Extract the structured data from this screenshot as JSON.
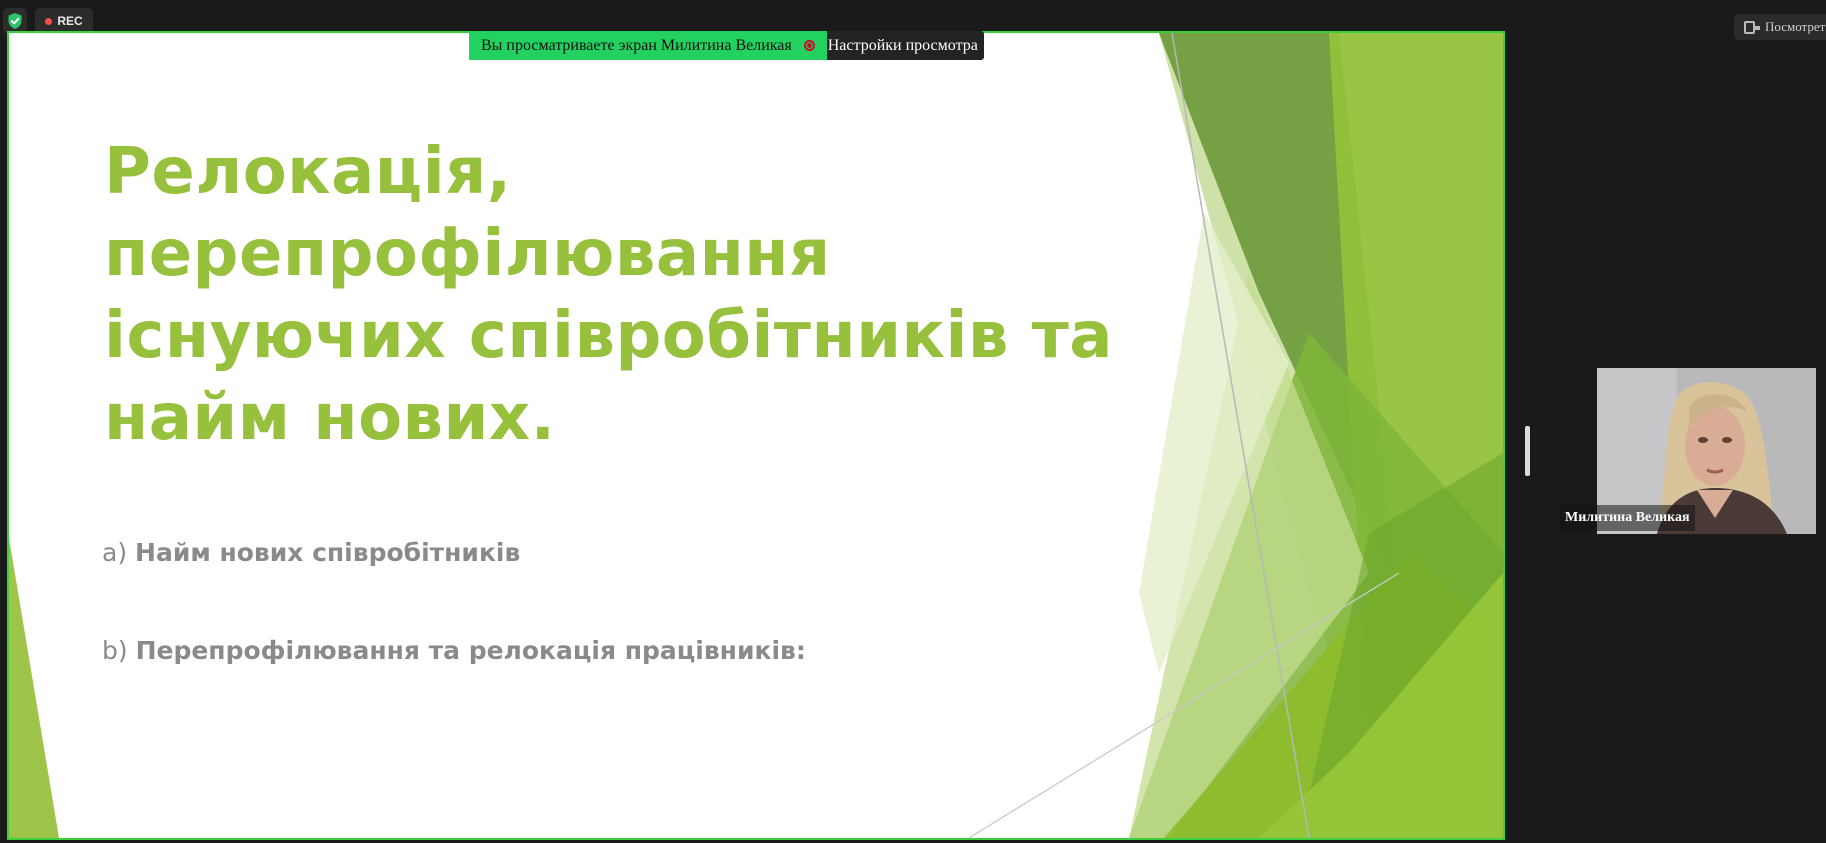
{
  "meeting": {
    "rec_label": "REC",
    "view_button_label": "Посмотреть",
    "banner_text": "Вы просматриваете экран Милитина Великая",
    "banner_settings_label": "Настройки просмотра",
    "participant_name": "Милитина Великая",
    "colors": {
      "share_border": "#3dcf3d",
      "banner_green": "#23d160",
      "rec_dot": "#ff4a4a"
    }
  },
  "slide": {
    "title": "Релокація, перепрофілювання існуючих співробітників та найм нових.",
    "bullets": [
      {
        "marker": "a)",
        "text": "Найм нових співробітників"
      },
      {
        "marker": "b)",
        "text": "Перепрофілювання та релокація працівників:"
      }
    ],
    "colors": {
      "title": "#97c03d",
      "body_text": "#8a8a8a",
      "accent_green": "#8dbb2a",
      "dark_green": "#5e8a2a"
    }
  },
  "icons": {
    "security": "shield-check-icon",
    "recording": "record-dot-icon",
    "view": "view-layout-icon",
    "banner_recording": "recording-indicator-icon"
  }
}
